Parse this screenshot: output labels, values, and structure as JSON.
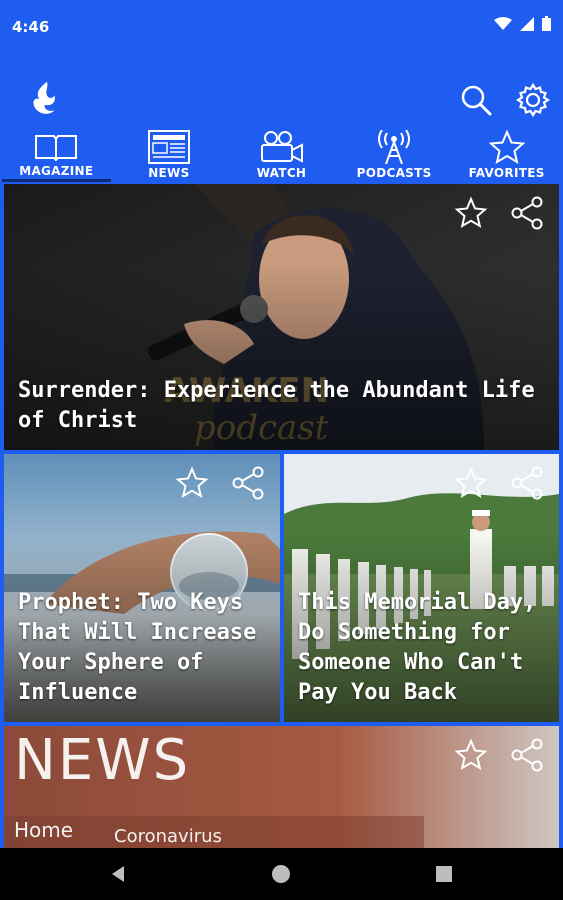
{
  "status": {
    "time": "4:46"
  },
  "appbar": {
    "logo": "flame-dove-logo",
    "search_icon": "search-icon",
    "settings_icon": "gear-icon"
  },
  "tabs": [
    {
      "label": "MAGAZINE",
      "icon": "book-icon",
      "active": true
    },
    {
      "label": "NEWS",
      "icon": "newspaper-icon",
      "active": false
    },
    {
      "label": "WATCH",
      "icon": "video-camera-icon",
      "active": false
    },
    {
      "label": "PODCASTS",
      "icon": "antenna-icon",
      "active": false
    },
    {
      "label": "FAVORITES",
      "icon": "star-icon",
      "active": false
    }
  ],
  "cards": [
    {
      "title": "Surrender: Experience the Abundant Life of Christ",
      "image": "man singing into microphone on stage"
    },
    {
      "title": "Prophet: Two Keys That Will Increase Your Sphere of Influence",
      "image": "hand holding glass sphere at beach"
    },
    {
      "title": "This Memorial Day, Do Something for Someone Who Can't Pay You Back",
      "image": "sailor at military cemetery"
    },
    {
      "title": "",
      "image": "news website close-up",
      "visible_text": [
        "NEWS",
        "Home",
        "Coronavirus"
      ]
    }
  ],
  "colors": {
    "primary": "#1f5cf0",
    "tab_indicator": "#0d2a75",
    "nav": "#000000"
  }
}
